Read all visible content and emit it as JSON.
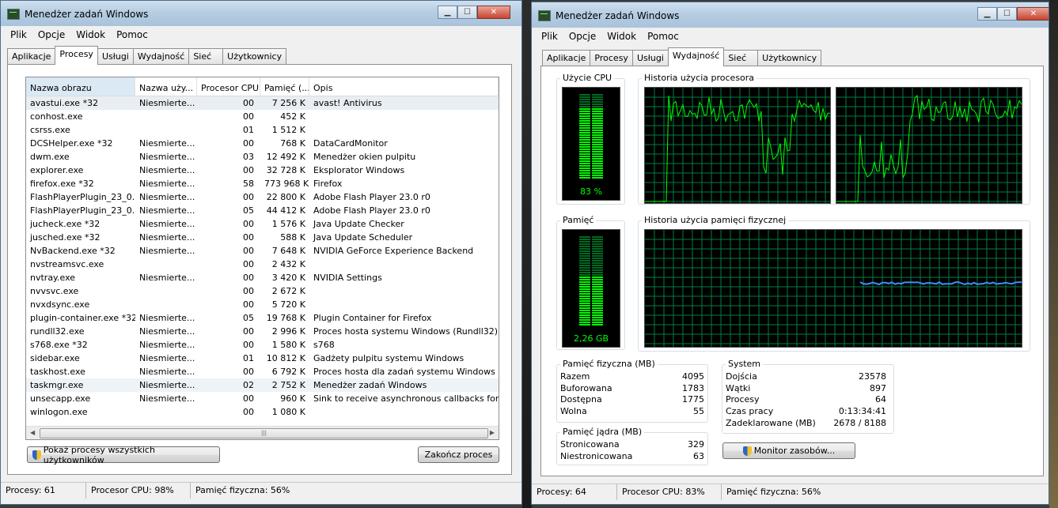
{
  "left": {
    "title": "Menedżer zadań Windows",
    "menu": [
      "Plik",
      "Opcje",
      "Widok",
      "Pomoc"
    ],
    "tabs": [
      "Aplikacje",
      "Procesy",
      "Usługi",
      "Wydajność",
      "Sieć",
      "Użytkownicy"
    ],
    "active_tab": "Procesy",
    "columns": [
      "Nazwa obrazu",
      "Nazwa uży...",
      "Procesor CPU",
      "Pamięć (...",
      "Opis"
    ],
    "rows": [
      [
        "avastui.exe *32",
        "Niesmierte...",
        "00",
        "7 256 K",
        "avast! Antivirus"
      ],
      [
        "conhost.exe",
        "",
        "00",
        "452 K",
        ""
      ],
      [
        "csrss.exe",
        "",
        "01",
        "1 512 K",
        ""
      ],
      [
        "DCSHelper.exe *32",
        "Niesmierte...",
        "00",
        "768 K",
        "DataCardMonitor"
      ],
      [
        "dwm.exe",
        "Niesmierte...",
        "03",
        "12 492 K",
        "Menedżer okien pulpitu"
      ],
      [
        "explorer.exe",
        "Niesmierte...",
        "00",
        "32 728 K",
        "Eksplorator Windows"
      ],
      [
        "firefox.exe *32",
        "Niesmierte...",
        "58",
        "773 968 K",
        "Firefox"
      ],
      [
        "FlashPlayerPlugin_23_0...",
        "Niesmierte...",
        "00",
        "22 800 K",
        "Adobe Flash Player 23.0 r0"
      ],
      [
        "FlashPlayerPlugin_23_0...",
        "Niesmierte...",
        "05",
        "44 412 K",
        "Adobe Flash Player 23.0 r0"
      ],
      [
        "jucheck.exe *32",
        "Niesmierte...",
        "00",
        "1 576 K",
        "Java Update Checker"
      ],
      [
        "jusched.exe *32",
        "Niesmierte...",
        "00",
        "588 K",
        "Java Update Scheduler"
      ],
      [
        "NvBackend.exe *32",
        "Niesmierte...",
        "00",
        "7 648 K",
        "NVIDIA GeForce Experience Backend"
      ],
      [
        "nvstreamsvc.exe",
        "",
        "00",
        "2 432 K",
        ""
      ],
      [
        "nvtray.exe",
        "Niesmierte...",
        "00",
        "3 420 K",
        "NVIDIA Settings"
      ],
      [
        "nvvsvc.exe",
        "",
        "00",
        "2 672 K",
        ""
      ],
      [
        "nvxdsync.exe",
        "",
        "00",
        "5 720 K",
        ""
      ],
      [
        "plugin-container.exe *32",
        "Niesmierte...",
        "05",
        "19 768 K",
        "Plugin Container for Firefox"
      ],
      [
        "rundll32.exe",
        "Niesmierte...",
        "00",
        "2 996 K",
        "Proces hosta systemu Windows (Rundll32)"
      ],
      [
        "s768.exe *32",
        "Niesmierte...",
        "00",
        "1 580 K",
        "s768"
      ],
      [
        "sidebar.exe",
        "Niesmierte...",
        "01",
        "10 812 K",
        "Gadżety pulpitu systemu Windows"
      ],
      [
        "taskhost.exe",
        "Niesmierte...",
        "00",
        "6 792 K",
        "Proces hosta dla zadań systemu Windows"
      ],
      [
        "taskmgr.exe",
        "Niesmierte...",
        "02",
        "2 752 K",
        "Menedżer zadań Windows"
      ],
      [
        "unsecapp.exe",
        "Niesmierte...",
        "00",
        "960 K",
        "Sink to receive asynchronous callbacks for ..."
      ],
      [
        "winlogon.exe",
        "",
        "00",
        "1 080 K",
        ""
      ]
    ],
    "show_all_button": "Pokaż procesy wszystkich użytkowników",
    "end_process_button": "Zakończ proces",
    "status": {
      "processes": "Procesy: 61",
      "cpu": "Procesor CPU: 98%",
      "memory": "Pamięć fizyczna: 56%"
    }
  },
  "right": {
    "title": "Menedżer zadań Windows",
    "menu": [
      "Plik",
      "Opcje",
      "Widok",
      "Pomoc"
    ],
    "tabs": [
      "Aplikacje",
      "Procesy",
      "Usługi",
      "Wydajność",
      "Sieć",
      "Użytkownicy"
    ],
    "active_tab": "Wydajność",
    "cpu_usage_label": "Użycie CPU",
    "cpu_usage_value": "83 %",
    "cpu_usage_level": 0.83,
    "cpu_history_label": "Historia użycia procesora",
    "memory_label": "Pamięć",
    "memory_value": "2,26 GB",
    "memory_level": 0.56,
    "memory_history_label": "Historia użycia pamięci fizycznej",
    "physical_memory": {
      "title": "Pamięć fizyczna (MB)",
      "rows": [
        [
          "Razem",
          "4095"
        ],
        [
          "Buforowana",
          "1783"
        ],
        [
          "Dostępna",
          "1775"
        ],
        [
          "Wolna",
          "55"
        ]
      ]
    },
    "kernel_memory": {
      "title": "Pamięć jądra (MB)",
      "rows": [
        [
          "Stronicowana",
          "329"
        ],
        [
          "Niestronicowana",
          "63"
        ]
      ]
    },
    "system": {
      "title": "System",
      "rows": [
        [
          "Dojścia",
          "23578"
        ],
        [
          "Wątki",
          "897"
        ],
        [
          "Procesy",
          "64"
        ],
        [
          "Czas pracy",
          "0:13:34:41"
        ],
        [
          "Zadeklarowane (MB)",
          "2678 / 8188"
        ]
      ]
    },
    "resource_monitor_button": "Monitor zasobów...",
    "status": {
      "processes": "Procesy: 64",
      "cpu": "Procesor CPU: 83%",
      "memory": "Pamięć fizyczna: 56%"
    }
  },
  "colors": {
    "graph_bg": "#000000",
    "grid": "#008040",
    "cpu_line": "#00ff00",
    "mem_line": "#3e8eff",
    "meter_on": "#00ff00",
    "meter_off": "#006a22"
  }
}
